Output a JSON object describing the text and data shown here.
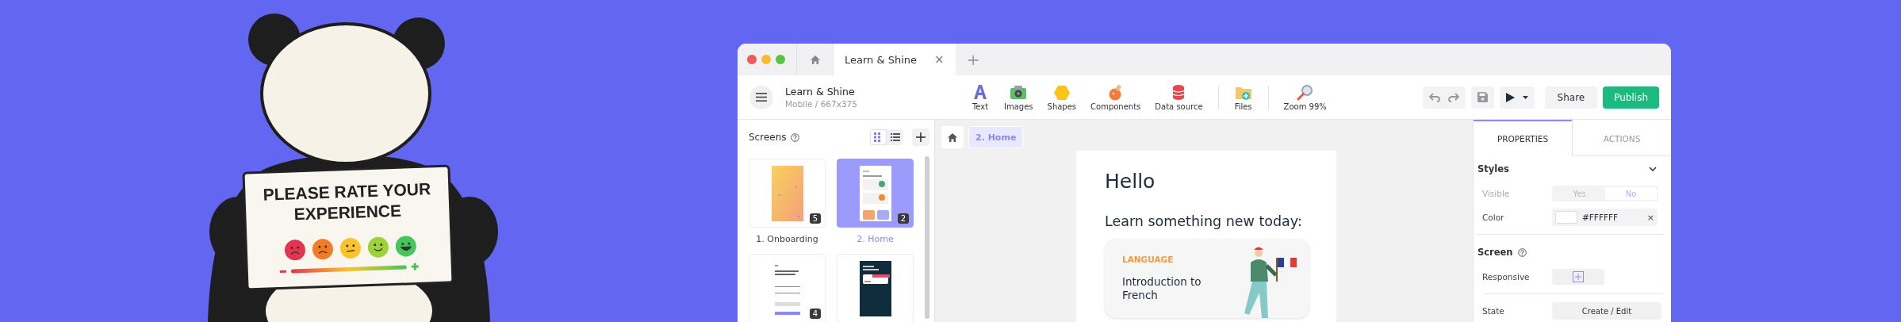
{
  "poster": {
    "sign_text": "PLEASE RATE YOUR EXPERIENCE"
  },
  "window": {
    "tabs": [
      {
        "kind": "home",
        "selected": false
      },
      {
        "kind": "doc",
        "label": "Learn & Shine",
        "close": "×",
        "selected": true
      }
    ],
    "new_tab": "+"
  },
  "project": {
    "name": "Learn & Shine",
    "device": "Mobile / 667x375"
  },
  "tools": [
    {
      "kind": "text",
      "label": "Text",
      "divider_before": false
    },
    {
      "kind": "images",
      "label": "Images",
      "divider_before": false
    },
    {
      "kind": "shapes",
      "label": "Shapes",
      "divider_before": false
    },
    {
      "kind": "components",
      "label": "Components",
      "divider_before": false
    },
    {
      "kind": "data",
      "label": "Data source",
      "divider_before": false
    },
    {
      "kind": "files",
      "label": "Files",
      "divider_before": true
    },
    {
      "kind": "zoom",
      "label": "Zoom 99%",
      "divider_before": true
    }
  ],
  "actions": {
    "share": "Share",
    "publish": "Publish"
  },
  "screens_panel": {
    "title": "Screens",
    "views": [
      {
        "kind": "grid",
        "selected": true
      },
      {
        "kind": "list",
        "selected": false
      }
    ]
  },
  "screens": [
    {
      "kind": "gradient",
      "label": "1. Onboarding",
      "count": "5",
      "selected": false
    },
    {
      "kind": "home",
      "label": "2. Home",
      "count": "2",
      "selected": true
    },
    {
      "kind": "form",
      "count": "4",
      "selected": false
    },
    {
      "kind": "dark",
      "selected": false
    }
  ],
  "breadcrumb": {
    "label": "2. Home"
  },
  "preview": {
    "heading": "Hello",
    "subheading": "Learn something new today:",
    "card": {
      "category": "LANGUAGE",
      "title": "Introduction to French"
    }
  },
  "properties": {
    "tabs": [
      {
        "label": "PROPERTIES",
        "selected": true
      },
      {
        "label": "ACTIONS",
        "selected": false
      }
    ],
    "styles": {
      "title": "Styles",
      "expanded": true,
      "visible": {
        "label": "Visible",
        "disabled": true,
        "options": [
          {
            "label": "Yes",
            "selected": false
          },
          {
            "label": "No",
            "selected": true
          }
        ]
      },
      "color": {
        "label": "Color",
        "value": "#FFFFFF",
        "clear": "×"
      }
    },
    "screen": {
      "title": "Screen",
      "responsive": {
        "label": "Responsive"
      },
      "state": {
        "label": "State",
        "button": "Create / Edit"
      }
    }
  }
}
